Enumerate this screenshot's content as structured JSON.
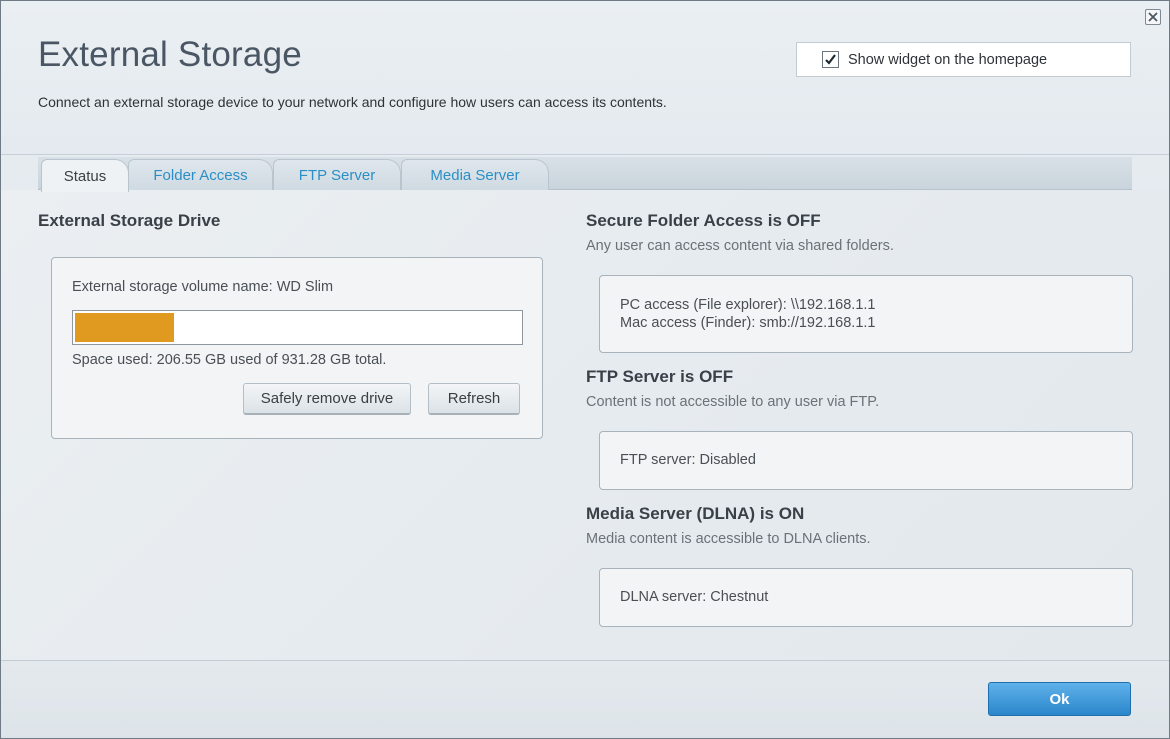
{
  "header": {
    "title": "External Storage",
    "subtitle": "Connect an external storage device to your network and configure how users can access its contents.",
    "widget_label": "Show widget on the homepage",
    "widget_checked": true
  },
  "tabs": [
    {
      "label": "Status",
      "active": true
    },
    {
      "label": "Folder Access",
      "active": false
    },
    {
      "label": "FTP Server",
      "active": false
    },
    {
      "label": "Media Server",
      "active": false
    }
  ],
  "drive": {
    "heading": "External Storage Drive",
    "volume_name": "External storage volume name: WD Slim",
    "space_used_text": "Space used: 206.55 GB used of 931.28 GB total.",
    "used_fraction": 0.222,
    "safely_remove_label": "Safely remove drive",
    "refresh_label": "Refresh"
  },
  "secure_folder": {
    "heading": "Secure Folder Access is OFF",
    "desc": "Any user can access content via shared folders.",
    "pc_access": "PC access (File explorer): \\\\192.168.1.1",
    "mac_access": "Mac access (Finder): smb://192.168.1.1"
  },
  "ftp": {
    "heading": "FTP Server is OFF",
    "desc": "Content is not accessible to any user via FTP.",
    "status": "FTP server: Disabled"
  },
  "media": {
    "heading": "Media Server (DLNA) is ON",
    "desc": "Media content is accessible to DLNA clients.",
    "status": "DLNA server: Chestnut"
  },
  "footer": {
    "ok_label": "Ok"
  },
  "colors": {
    "progress_fill": "#e09a1f",
    "accent_blue": "#2b86cb",
    "tab_link": "#2b8fc6"
  },
  "icons": {
    "close": "close-icon",
    "checkbox": "checkmark-icon"
  }
}
